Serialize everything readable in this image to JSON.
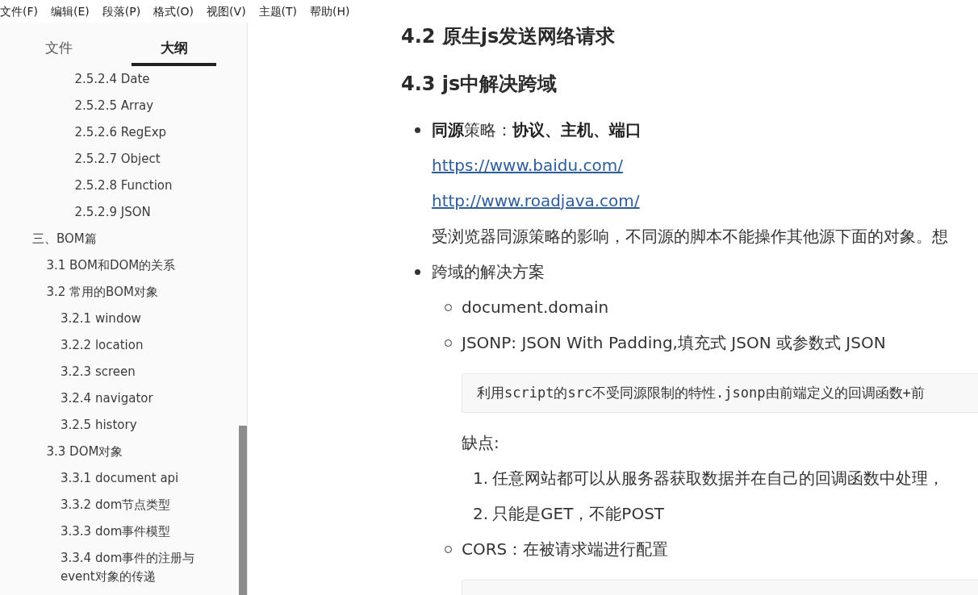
{
  "menu_bar": {
    "items": [
      "文件(F)",
      "编辑(E)",
      "段落(P)",
      "格式(O)",
      "视图(V)",
      "主题(T)",
      "帮助(H)"
    ]
  },
  "sidebar": {
    "tabs": [
      {
        "label": "文件",
        "selected": false
      },
      {
        "label": "大纲",
        "selected": true
      }
    ],
    "outline": [
      {
        "children": [
          {
            "children": [
              {
                "children": [
                  {
                    "label": "2.5.2.4 Date"
                  },
                  {
                    "label": "2.5.2.5 Array"
                  },
                  {
                    "label": "2.5.2.6 RegExp"
                  },
                  {
                    "label": "2.5.2.7 Object"
                  },
                  {
                    "label": "2.5.2.8 Function"
                  },
                  {
                    "label": "2.5.2.9 JSON"
                  }
                ]
              }
            ]
          }
        ]
      },
      {
        "label": "三、BOM篇",
        "children": [
          {
            "label": "3.1 BOM和DOM的关系"
          },
          {
            "label": "3.2 常用的BOM对象",
            "children": [
              {
                "label": "3.2.1 window"
              },
              {
                "label": "3.2.2 location"
              },
              {
                "label": "3.2.3 screen"
              },
              {
                "label": "3.2.4 navigator"
              },
              {
                "label": "3.2.5 history"
              }
            ]
          },
          {
            "label": "3.3 DOM对象",
            "children": [
              {
                "label": "3.3.1 document api"
              },
              {
                "label": "3.3.2 dom节点类型"
              },
              {
                "label": "3.3.3 dom事件模型"
              },
              {
                "label": "3.3.4 dom事件的注册与event对象的传递"
              }
            ]
          }
        ]
      }
    ]
  },
  "document": {
    "blocks": [
      {
        "kind": "heading",
        "text": "4.2 原生js发送网络请求"
      },
      {
        "kind": "heading",
        "text": "4.3 js中解决跨域"
      },
      {
        "kind": "bullet_list",
        "items": [
          {
            "text": "**同源**策略：**协议、主机、端口**",
            "blocks": [
              {
                "kind": "link",
                "text": "https://www.baidu.com/"
              },
              {
                "kind": "link",
                "text": "http://www.roadjava.com/"
              },
              {
                "kind": "paragraph",
                "text": "受浏览器同源策略的影响，不同源的脚本不能操作其他源下面的对象。想"
              }
            ]
          },
          {
            "text": "跨域的解决方案",
            "blocks": [
              {
                "kind": "bullet_list",
                "items": [
                  {
                    "text": "document.domain"
                  },
                  {
                    "text": "JSONP: JSON With Padding,填充式 JSON 或参数式 JSON",
                    "blocks": [
                      {
                        "kind": "code",
                        "text": "利用script的src不受同源限制的特性.jsonp由前端定义的回调函数+前"
                      },
                      {
                        "kind": "paragraph",
                        "text": "缺点:"
                      },
                      {
                        "kind": "ordered_list",
                        "items": [
                          {
                            "number": "1.",
                            "text": "任意网站都可以从服务器获取数据并在自己的回调函数中处理，"
                          },
                          {
                            "number": "2.",
                            "text": "只能是GET，不能POST"
                          }
                        ]
                      }
                    ]
                  },
                  {
                    "text": "CORS：在被请求端进行配置",
                    "blocks": [
                      {
                        "kind": "code"
                      }
                    ]
                  }
                ]
              }
            ]
          }
        ]
      }
    ]
  }
}
